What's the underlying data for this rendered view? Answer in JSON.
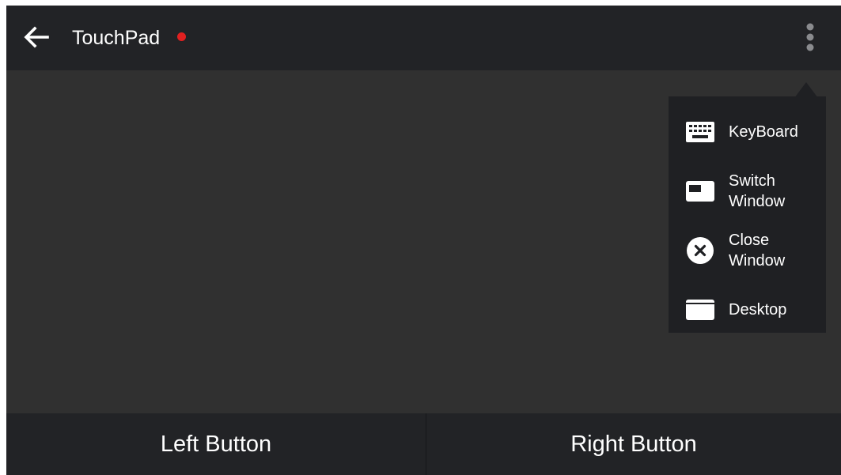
{
  "header": {
    "title": "TouchPad",
    "back_icon": "arrow-left-icon",
    "more_icon": "more-vertical-icon",
    "status_dot_color": "#e02020"
  },
  "menu": {
    "items": [
      {
        "label": "KeyBoard",
        "icon": "keyboard-icon"
      },
      {
        "label": "Switch\nWindow",
        "icon": "switch-window-icon"
      },
      {
        "label": "Close\nWindow",
        "icon": "close-window-icon"
      },
      {
        "label": "Desktop",
        "icon": "desktop-icon"
      }
    ]
  },
  "bottom": {
    "left_label": "Left Button",
    "right_label": "Right Button"
  },
  "colors": {
    "background": "#303030",
    "bar": "#222326",
    "menu": "#1f2023",
    "text": "#ffffff"
  }
}
